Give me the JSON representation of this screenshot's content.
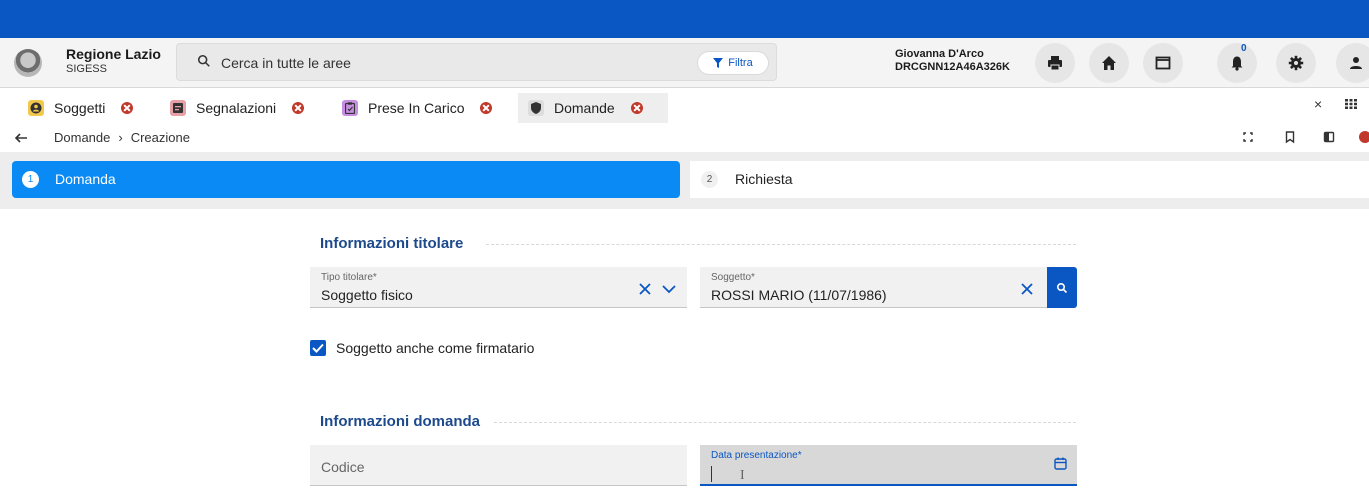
{
  "header": {
    "brand_title": "Regione Lazio",
    "brand_sub": "SIGESS",
    "search_placeholder": "Cerca in tutte le aree",
    "filter_label": "Filtra",
    "user_name": "Giovanna D'Arco",
    "user_code": "DRCGNN12A46A326K",
    "notification_count": "0",
    "icons": [
      "print-icon",
      "home-icon",
      "window-icon",
      "bell-icon",
      "gear-icon",
      "user-icon"
    ]
  },
  "tabs": [
    {
      "label": "Soggetti",
      "icon": "person-icon",
      "color": "#f2c94c"
    },
    {
      "label": "Segnalazioni",
      "icon": "report-icon",
      "color": "#e8a0a8"
    },
    {
      "label": "Prese In Carico",
      "icon": "clipboard-icon",
      "color": "#c58ee0"
    },
    {
      "label": "Domande",
      "icon": "shield-icon",
      "color": "#dddddd",
      "active": true
    }
  ],
  "tabs_close_all": "×",
  "breadcrumb": {
    "items": [
      "Domande",
      "Creazione"
    ],
    "separator": "›"
  },
  "stepper": {
    "steps": [
      {
        "num": "1",
        "label": "Domanda",
        "active": true
      },
      {
        "num": "2",
        "label": "Richiesta",
        "active": false
      }
    ]
  },
  "titolare": {
    "section_title": "Informazioni titolare",
    "tipo_label": "Tipo titolare*",
    "tipo_value": "Soggetto fisico",
    "soggetto_label": "Soggetto*",
    "soggetto_value": "ROSSI MARIO (11/07/1986)",
    "firmatario_label": "Soggetto anche come firmatario",
    "firmatario_checked": true
  },
  "domanda": {
    "section_title": "Informazioni domanda",
    "codice_placeholder": "Codice",
    "data_label": "Data presentazione*"
  },
  "colors": {
    "primary": "#0a56c2",
    "step_active": "#0a8af4",
    "section_title": "#1d4a8c",
    "tab_close": "#c0392b"
  }
}
